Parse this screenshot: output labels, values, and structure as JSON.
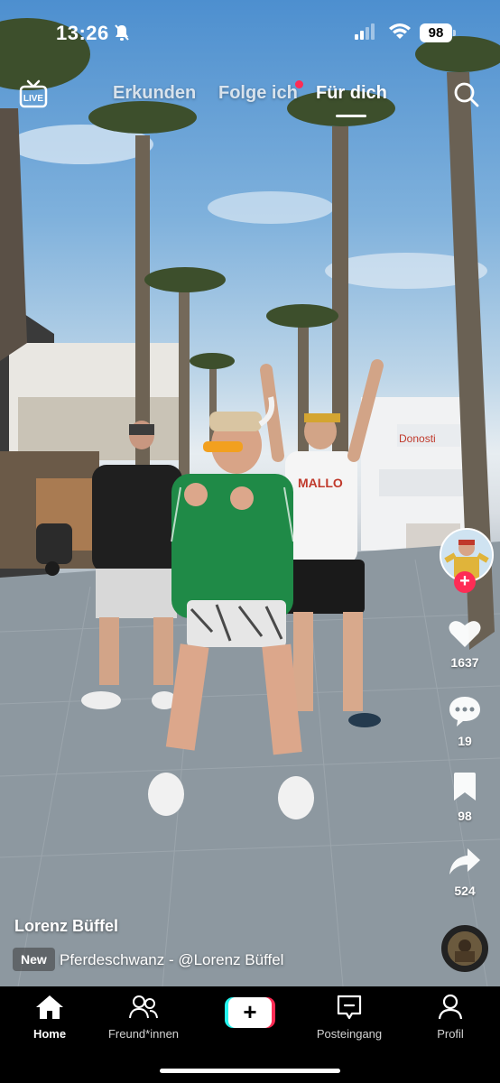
{
  "status_bar": {
    "time": "13:26",
    "battery": "98"
  },
  "top_nav": {
    "tabs": [
      {
        "label": "Erkunden",
        "active": false
      },
      {
        "label": "Folge ich",
        "active": false,
        "has_dot": true
      },
      {
        "label": "Für dich",
        "active": true
      }
    ],
    "live_icon": "live-tv-icon",
    "search_icon": "search-icon"
  },
  "video": {
    "author": "Lorenz Büffel",
    "music_badge": "New",
    "music": "Pferdeschwanz - @Lorenz Büffel"
  },
  "actions": {
    "likes": "1637",
    "comments": "19",
    "saves": "98",
    "shares": "524"
  },
  "bottom_nav": {
    "home": "Home",
    "friends": "Freund*innen",
    "inbox": "Posteingang",
    "profile": "Profil"
  },
  "colors": {
    "accent": "#fe2c55",
    "cyan": "#25f4ee"
  }
}
